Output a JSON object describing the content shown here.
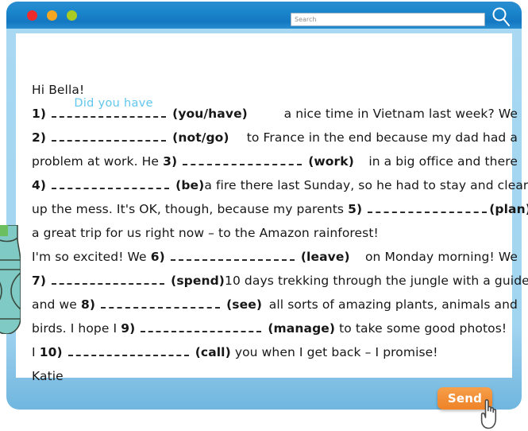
{
  "window": {
    "traffic_lights": [
      {
        "name": "close",
        "color": "#ee2b2b"
      },
      {
        "name": "minimize",
        "color": "#f5a623"
      },
      {
        "name": "zoom",
        "color": "#aacc22"
      }
    ],
    "titlebar_color": "#1b86cc",
    "body_color": "#a2d5f0"
  },
  "search": {
    "placeholder": "Search",
    "value": "",
    "icon": "magnifier-icon"
  },
  "letter": {
    "greeting": "Hi Bella!",
    "signature": "Katie",
    "answer_color": "#62c6ef",
    "lines": [
      {
        "id": "l1a",
        "number": "1)",
        "answer": "Did you have",
        "cue": "(you/have)",
        "after": "a nice time in Vietnam last week? We"
      },
      {
        "id": "l2",
        "number": "2)",
        "answer": "",
        "cue": "(not/go)",
        "after": "to France in the end because my dad had a"
      },
      {
        "id": "l3",
        "before": "problem at work. He",
        "number": "3)",
        "answer": "",
        "cue": "(work)",
        "after": "in a big office and there"
      },
      {
        "id": "l4",
        "number": "4)",
        "answer": "",
        "cue": "(be)",
        "after": "a fire there last Sunday, so he had to stay and clear"
      },
      {
        "id": "l5",
        "before": "up the mess. It's OK, though, because my parents",
        "number": "5)",
        "answer": "",
        "cue": "(plan)",
        "after": ""
      },
      {
        "id": "l5b",
        "plain": "a great trip for us right now – to the Amazon rainforest!"
      },
      {
        "id": "l6",
        "before": "I'm so excited! We",
        "number": "6)",
        "answer": "",
        "cue": "(leave)",
        "after": "on Monday morning! We"
      },
      {
        "id": "l7",
        "number": "7)",
        "answer": "",
        "cue": "(spend)",
        "after": "10 days trekking through the jungle with a guide"
      },
      {
        "id": "l8",
        "before": "and we",
        "number": "8)",
        "answer": "",
        "cue": "(see)",
        "after": "all sorts of amazing plants, animals and"
      },
      {
        "id": "l9",
        "before": "birds. I hope I",
        "number": "9)",
        "answer": "",
        "cue": "(manage)",
        "after": "to take some good photos!"
      },
      {
        "id": "l10",
        "before": "I",
        "number": "10)",
        "answer": "",
        "cue": "(call)",
        "after": "you when I get back – I promise!"
      }
    ]
  },
  "actions": {
    "send_label": "Send",
    "send_color": "#ef8327"
  },
  "decoration": {
    "left_illustration": "plant-illustration"
  }
}
